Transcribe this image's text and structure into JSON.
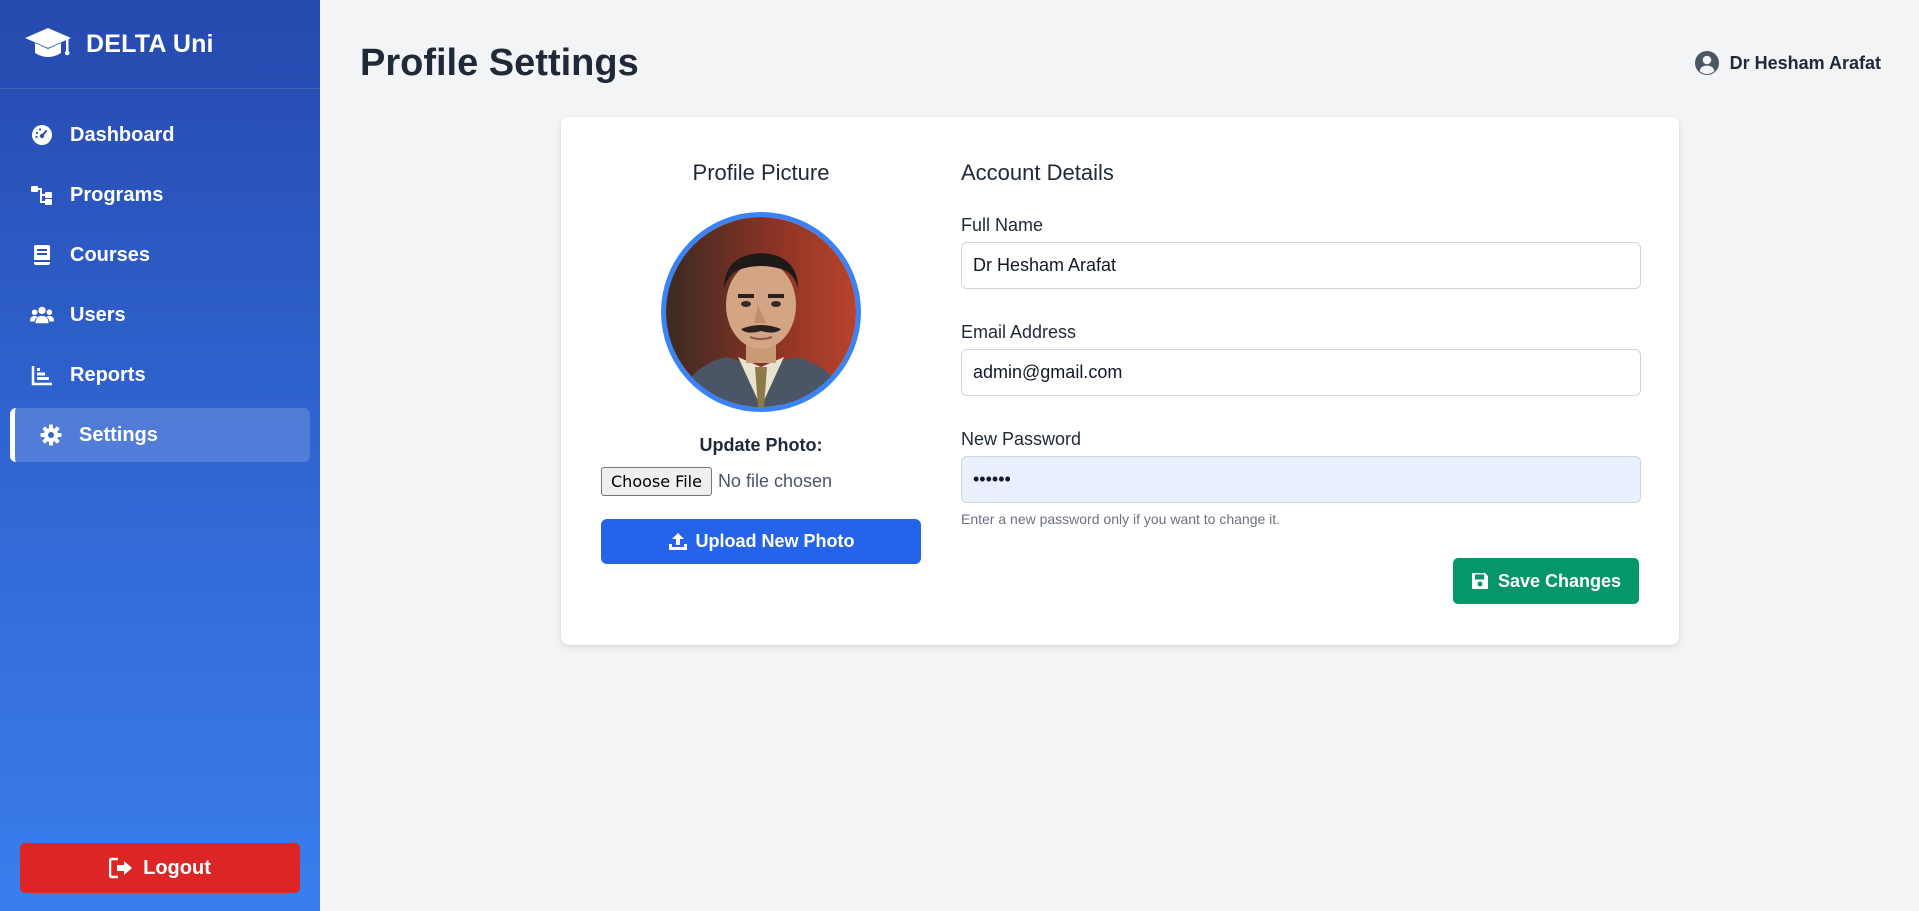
{
  "sidebar": {
    "brand": "DELTA Uni",
    "brand_icon": "graduation-cap-icon",
    "items": [
      {
        "label": "Dashboard",
        "icon": "gauge-icon"
      },
      {
        "label": "Programs",
        "icon": "sitemap-icon"
      },
      {
        "label": "Courses",
        "icon": "book-icon"
      },
      {
        "label": "Users",
        "icon": "users-icon"
      },
      {
        "label": "Reports",
        "icon": "chart-icon"
      },
      {
        "label": "Settings",
        "icon": "gear-icon",
        "active": true
      }
    ],
    "logout_label": "Logout"
  },
  "header": {
    "title": "Profile Settings",
    "user_name": "Dr Hesham Arafat"
  },
  "profile_picture": {
    "heading": "Profile Picture",
    "update_label": "Update Photo:",
    "choose_file_label": "Choose File",
    "no_file_text": "No file chosen",
    "upload_button": "Upload New Photo"
  },
  "account": {
    "heading": "Account Details",
    "full_name_label": "Full Name",
    "full_name_value": "Dr Hesham Arafat",
    "email_label": "Email Address",
    "email_value": "admin@gmail.com",
    "password_label": "New Password",
    "password_value": "••••••",
    "password_hint": "Enter a new password only if you want to change it.",
    "save_button": "Save Changes"
  },
  "colors": {
    "sidebar_top": "#2649ae",
    "sidebar_bottom": "#3a7eed",
    "logout": "#dc2626",
    "upload": "#2563eb",
    "save": "#059669",
    "avatar_ring": "#3b82f6"
  }
}
